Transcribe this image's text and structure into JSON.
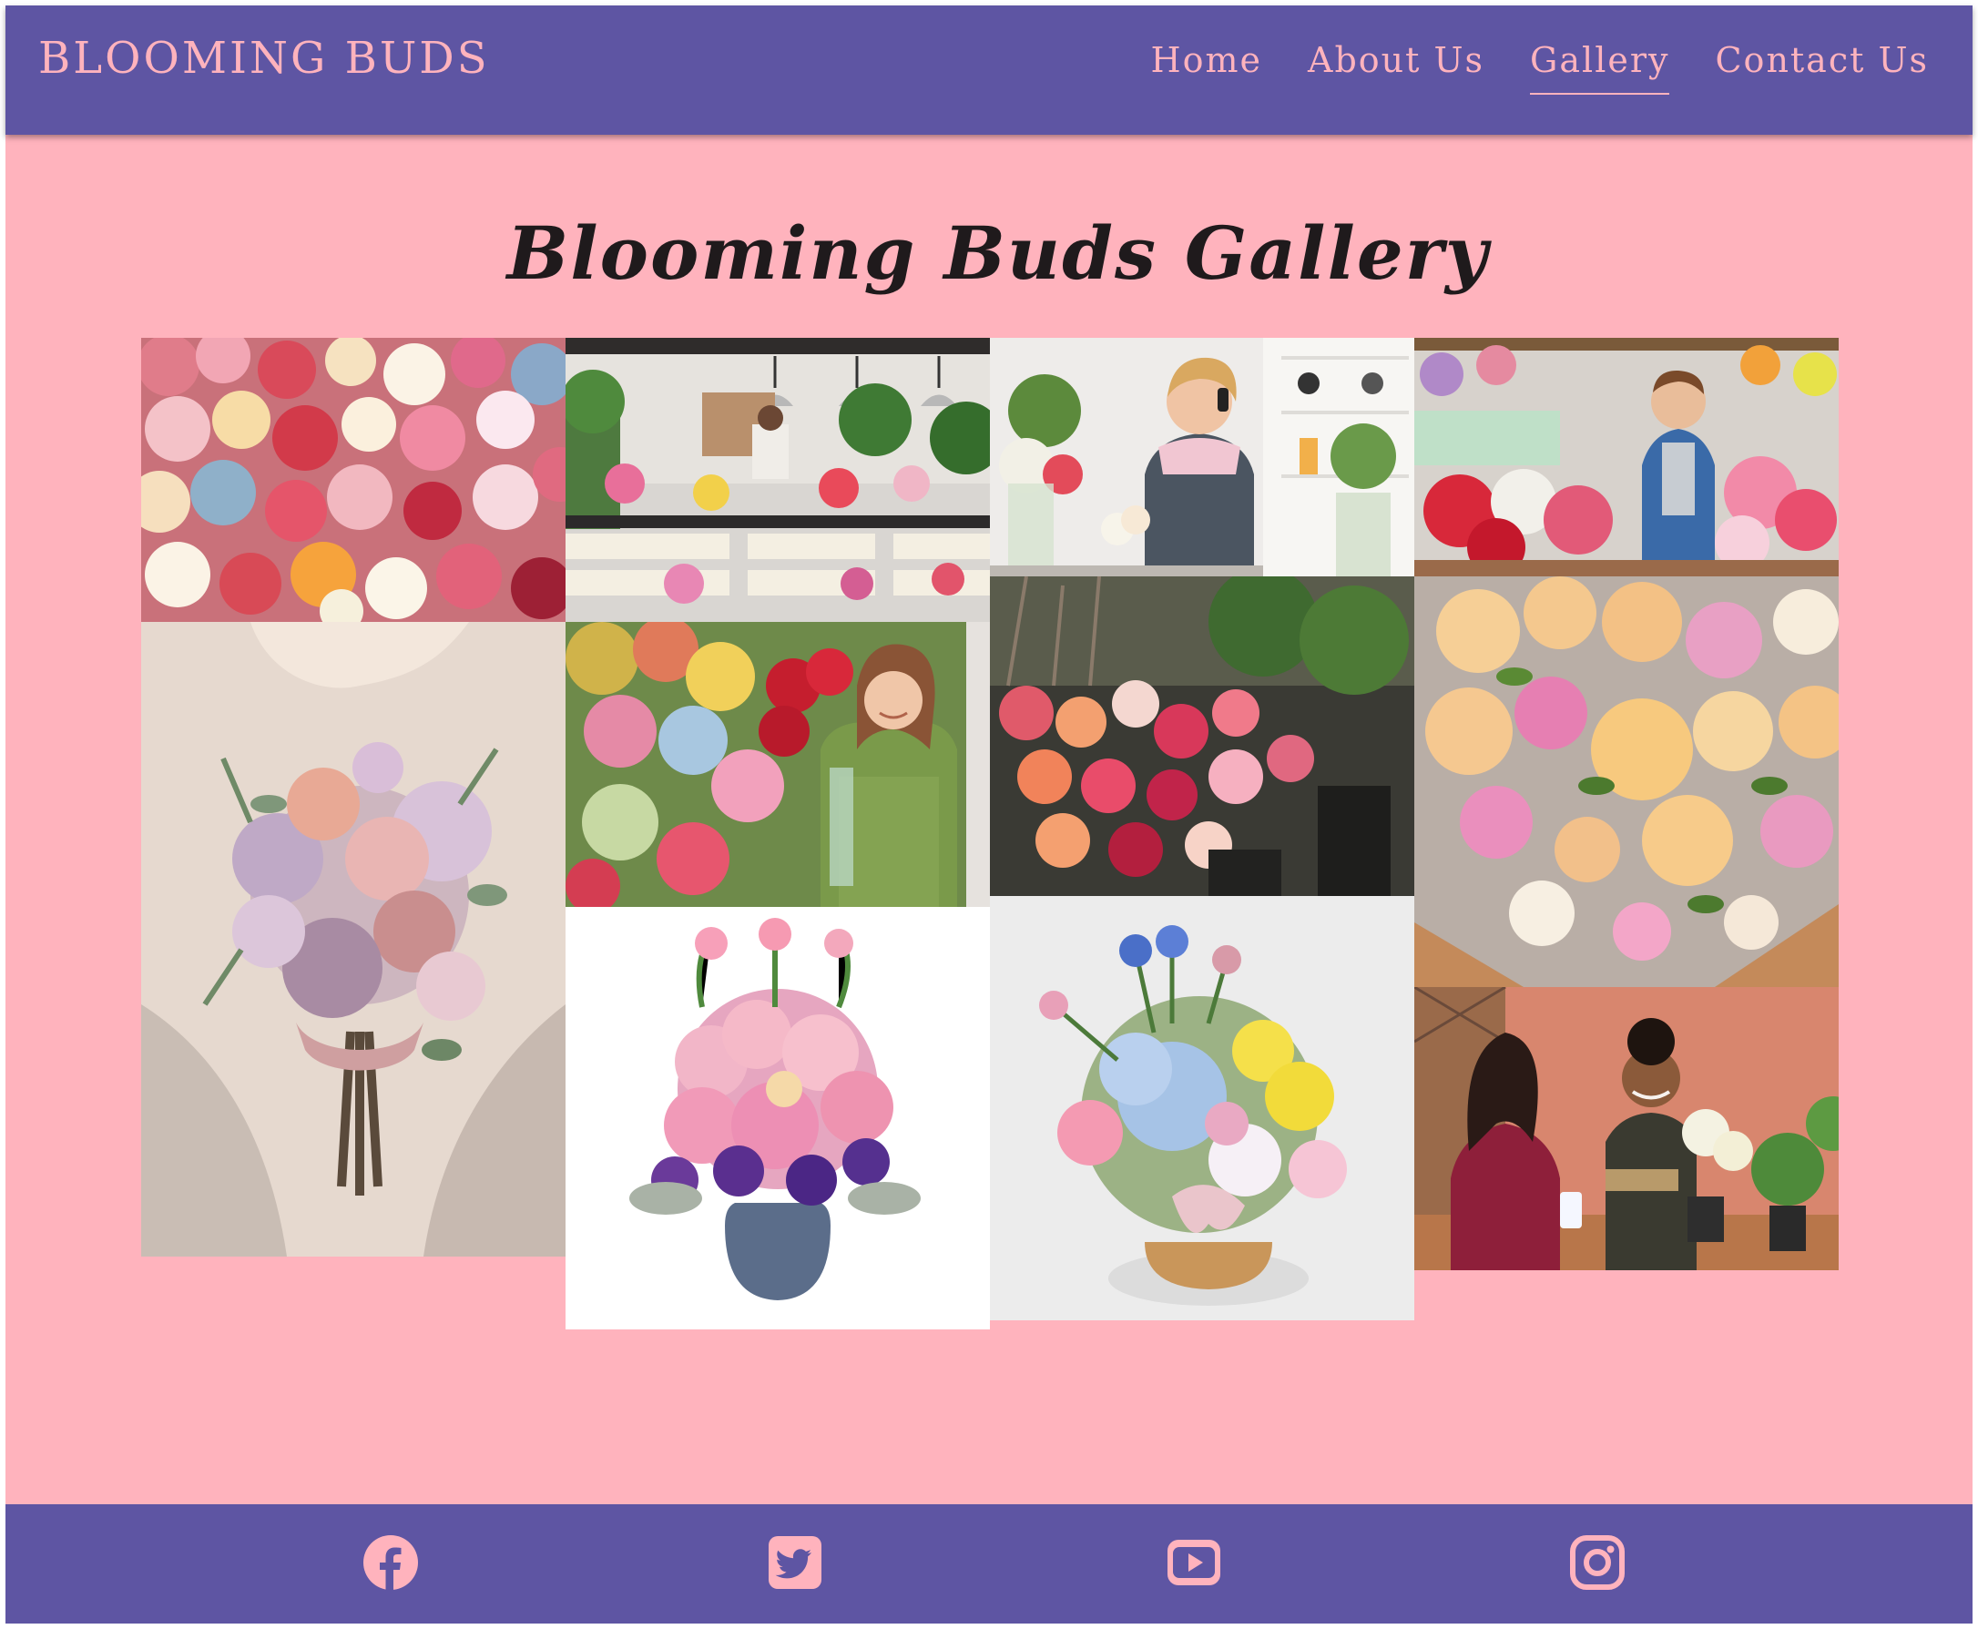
{
  "header": {
    "brand": "BLOOMING BUDS",
    "nav": [
      {
        "label": "Home",
        "active": false
      },
      {
        "label": "About Us",
        "active": false
      },
      {
        "label": "Gallery",
        "active": true
      },
      {
        "label": "Contact Us",
        "active": false
      }
    ]
  },
  "main": {
    "title": "Blooming Buds Gallery"
  },
  "gallery": {
    "images": [
      {
        "subject": "flower-market-photo"
      },
      {
        "subject": "florist-shop-interior-photo"
      },
      {
        "subject": "florist-on-phone-photo"
      },
      {
        "subject": "florist-man-with-flowers-photo"
      },
      {
        "subject": "bridal-bouquet-photo"
      },
      {
        "subject": "florist-woman-with-roses-photo"
      },
      {
        "subject": "flower-shop-displays-photo"
      },
      {
        "subject": "rose-bouquet-photo"
      },
      {
        "subject": "vase-arrangement-photo"
      },
      {
        "subject": "basket-arrangement-photo"
      },
      {
        "subject": "florist-serving-customer-photo"
      }
    ]
  },
  "footer": {
    "social": [
      {
        "icon": "facebook-icon"
      },
      {
        "icon": "twitter-icon"
      },
      {
        "icon": "youtube-icon"
      },
      {
        "icon": "instagram-icon"
      }
    ]
  },
  "colors": {
    "nav_background": "#5e55a3",
    "page_background": "#ffb3bd",
    "accent_text": "#ffb3bd",
    "title_text": "#1f1a1c"
  }
}
